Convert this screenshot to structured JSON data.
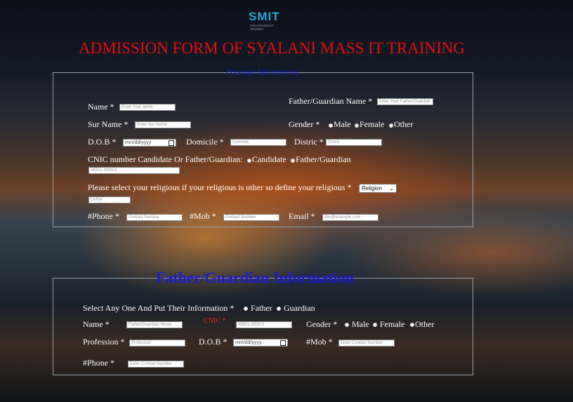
{
  "logo": {
    "text": "SMIT",
    "subtext": "SAYLANI MASS IT TRAINING"
  },
  "title": "ADMISSION FORM OF SYALANI MASS IT TRAINING",
  "personal": {
    "legend": "Personal Information",
    "name_label": "Name *",
    "name_placeholder": "Enter Your name",
    "father_label": "Father/Guardian Name *",
    "father_placeholder": "Enter Your Father/Guardian",
    "surname_label": "Sur Name *",
    "surname_placeholder": "Enter Sur Name",
    "gender_label": "Gender *",
    "gender_options": [
      "Male",
      "Female",
      "Other"
    ],
    "dob_label": "D.O.B *",
    "dob_value": "mm/dd/yyyy",
    "domicile_label": "Domicile *",
    "domicile_placeholder": "Domicile",
    "district_label": "Distric *",
    "district_placeholder": "Distric",
    "cnic_label": "CNIC number Candidate Or Father/Guardian:",
    "cnic_options": [
      "Candidate",
      "Father/Guardian"
    ],
    "cnic_placeholder": "45501-0000-0",
    "religion_label": "Please select your religious if your religious is other so define your religious *",
    "religion_selected": "Religion",
    "define_placeholder": "Define",
    "phone_label": "#Phone *",
    "phone_placeholder": "Contact Number",
    "mob_label": "#Mob *",
    "mob_placeholder": "Contact Number",
    "email_label": "Email *",
    "email_placeholder": "abc@example.com"
  },
  "guardian": {
    "legend": "Father/Guardian Information",
    "select_label": "Select Any One And Put Their Information *",
    "select_options": [
      "Father",
      "Guardian"
    ],
    "name_label": "Name *",
    "name_placeholder": "Father/Guardian Nmae",
    "cnic_label": "CNIC *",
    "cnic_placeholder": "45501-0000-0",
    "gender_label": "Gender *",
    "gender_options": [
      "Male",
      "Female",
      "Other"
    ],
    "profession_label": "Profession *",
    "profession_placeholder": "Profession",
    "dob_label": "D.O.B *",
    "dob_value": "mm/dd/yyyy",
    "mob_label": "#Mob *",
    "mob_placeholder": "Enter Contact Number",
    "phone_label": "#Phone *",
    "phone_placeholder": "Enter Contact Number"
  },
  "colors": {
    "title": "#e60d0d",
    "legend": "#1b1bd8",
    "logo": "#2ea3dc"
  }
}
